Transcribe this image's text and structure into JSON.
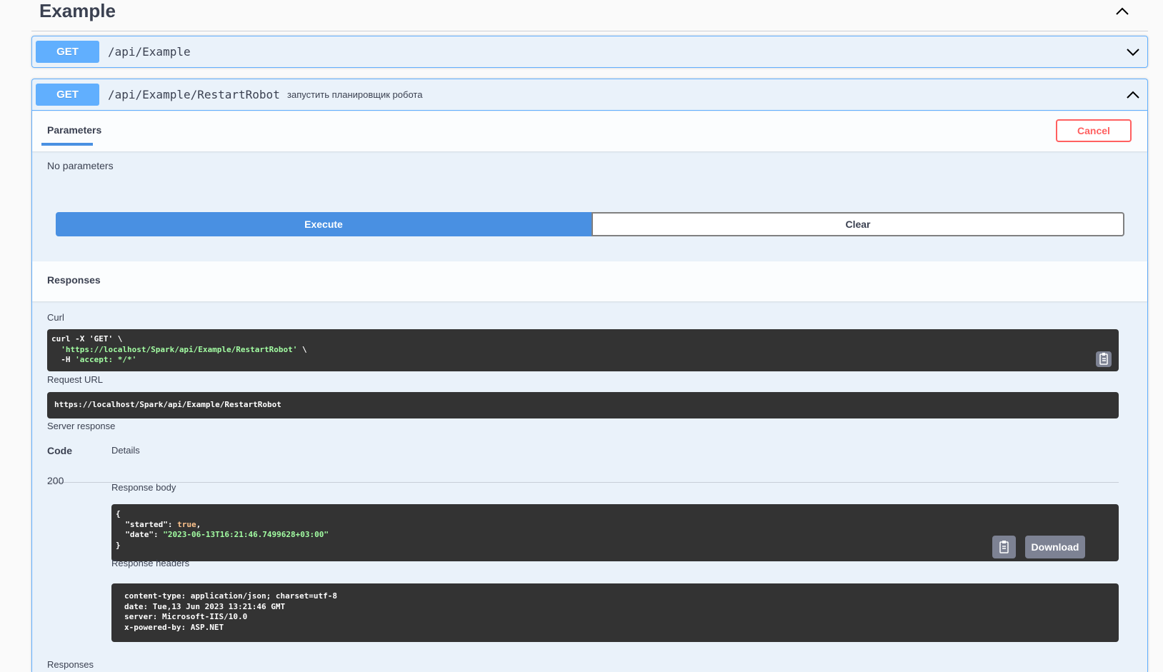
{
  "tag": {
    "title": "Example"
  },
  "operations": [
    {
      "method": "GET",
      "path": "/api/Example",
      "description": ""
    },
    {
      "method": "GET",
      "path": "/api/Example/RestartRobot",
      "description": "запустить планировщик робота"
    }
  ],
  "parameters": {
    "tab_label": "Parameters",
    "cancel_label": "Cancel",
    "empty_text": "No parameters",
    "execute_label": "Execute",
    "clear_label": "Clear"
  },
  "responses": {
    "title": "Responses",
    "curl_label": "Curl",
    "curl_line1": "curl -X 'GET' \\",
    "curl_line2_str": "'https://localhost/Spark/api/Example/RestartRobot'",
    "curl_line2_tail": " \\",
    "curl_line3_prefix": "-H ",
    "curl_line3_str": "'accept: */*'",
    "request_url_label": "Request URL",
    "request_url": "https://localhost/Spark/api/Example/RestartRobot",
    "server_response_label": "Server response",
    "code_header": "Code",
    "details_header": "Details",
    "status_code": "200",
    "response_body_label": "Response body",
    "body_open": "{",
    "body_key1": "\"started\": ",
    "body_val1": "true",
    "body_key2": "\"date\": ",
    "body_val2": "\"2023-06-13T16:21:46.7499628+03:00\"",
    "body_close": "}",
    "download_label": "Download",
    "response_headers_label": "Response headers",
    "headers": [
      "content-type: application/json; charset=utf-8",
      "date: Tue,13 Jun 2023 13:21:46 GMT",
      "server: Microsoft-IIS/10.0",
      "x-powered-by: ASP.NET"
    ],
    "footer_label": "Responses"
  },
  "colors": {
    "get_method": "#61affe",
    "execute": "#4990e2",
    "cancel": "#ff6060",
    "code_bg": "#333333"
  }
}
